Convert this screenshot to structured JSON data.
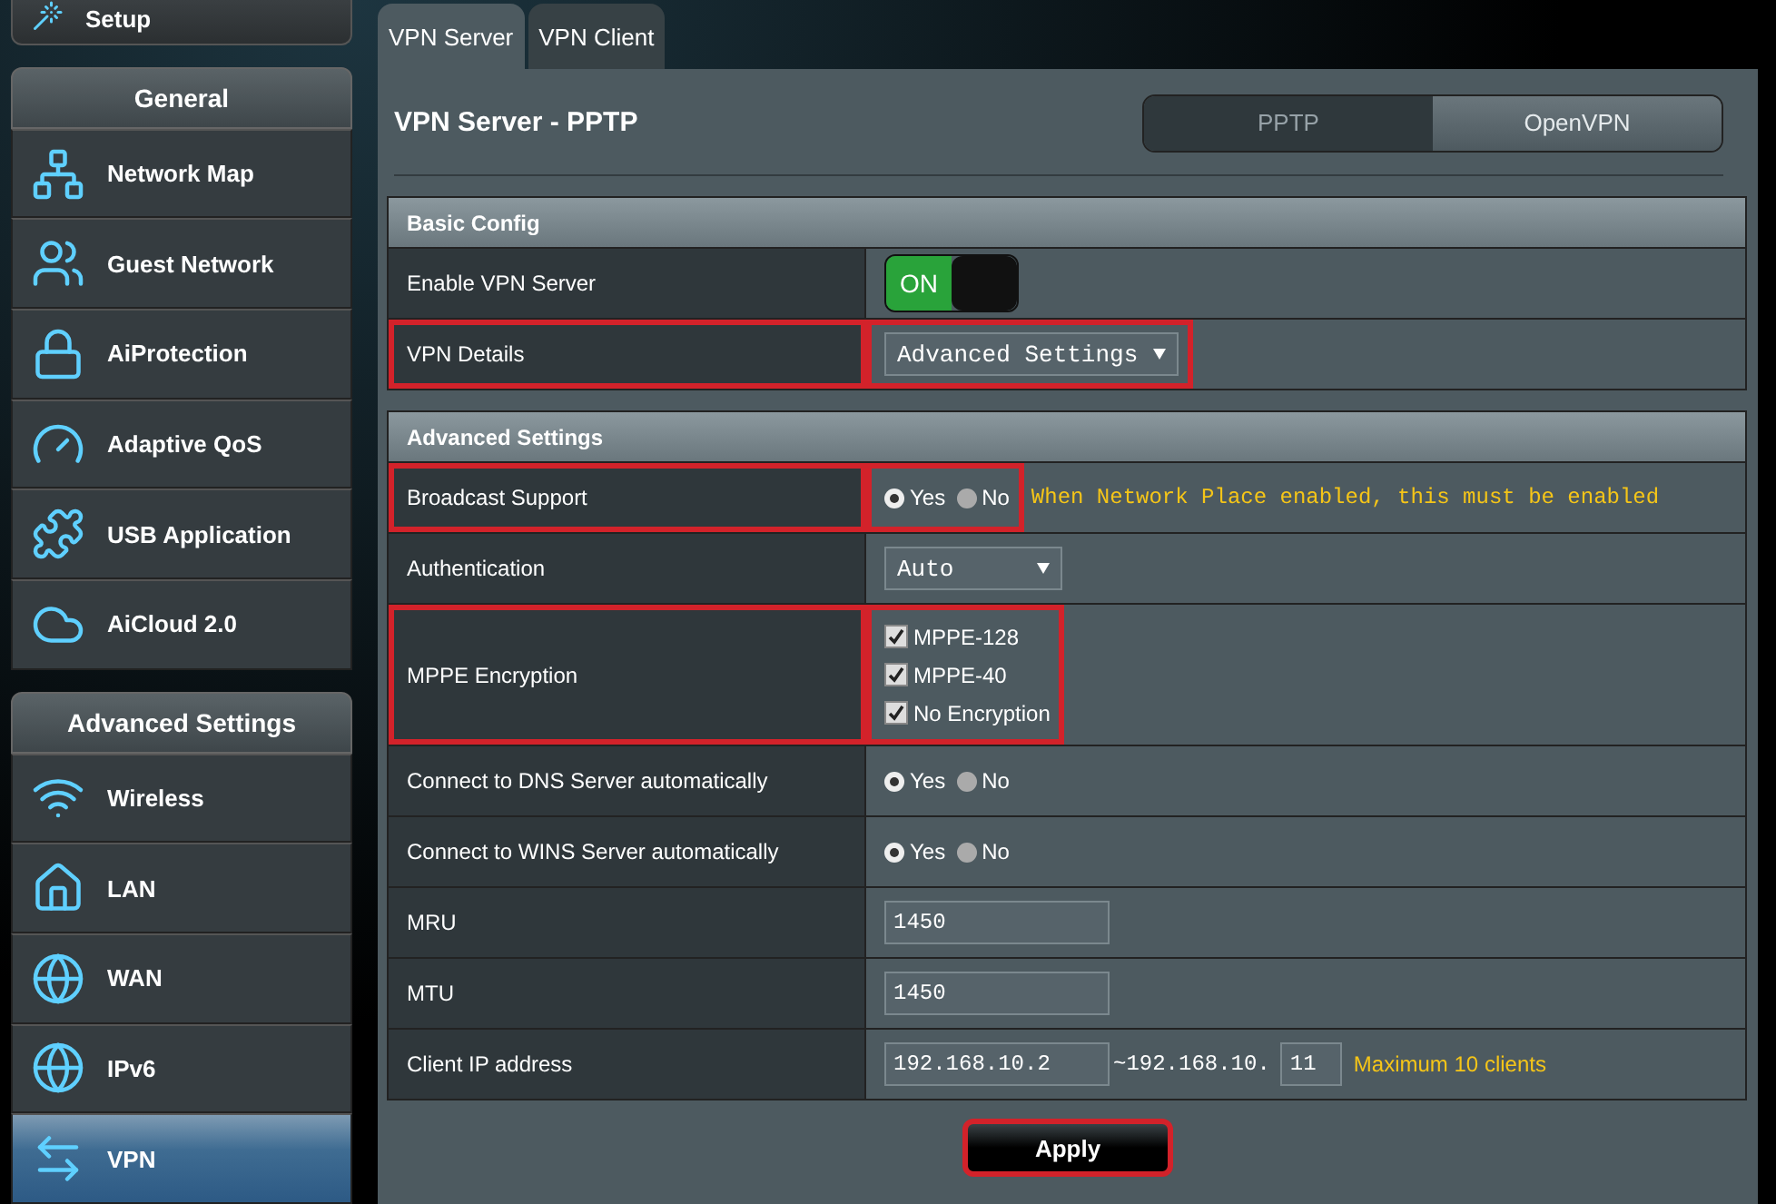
{
  "sidebar": {
    "top_item": {
      "label": "Setup"
    },
    "sections": [
      {
        "title": "General",
        "items": [
          {
            "label": "Network Map",
            "selected": false
          },
          {
            "label": "Guest Network",
            "selected": false
          },
          {
            "label": "AiProtection",
            "selected": false
          },
          {
            "label": "Adaptive QoS",
            "selected": false
          },
          {
            "label": "USB Application",
            "selected": false
          },
          {
            "label": "AiCloud 2.0",
            "selected": false
          }
        ]
      },
      {
        "title": "Advanced Settings",
        "items": [
          {
            "label": "Wireless",
            "selected": false
          },
          {
            "label": "LAN",
            "selected": false
          },
          {
            "label": "WAN",
            "selected": false
          },
          {
            "label": "IPv6",
            "selected": false
          },
          {
            "label": "VPN",
            "selected": true
          }
        ]
      }
    ]
  },
  "tabs": [
    {
      "label": "VPN Server",
      "selected": true
    },
    {
      "label": "VPN Client",
      "selected": false
    }
  ],
  "page_title": "VPN Server - PPTP",
  "protocol_switch": [
    {
      "label": "PPTP",
      "selected": true
    },
    {
      "label": "OpenVPN",
      "selected": false
    }
  ],
  "sections": [
    {
      "title": "Basic Config",
      "rows": [
        {
          "label": "Enable VPN Server",
          "kind": "toggle",
          "value": "ON",
          "on": true,
          "highlighted": false
        },
        {
          "label": "VPN Details",
          "kind": "select",
          "value": "Advanced Settings",
          "highlighted": true
        }
      ]
    },
    {
      "title": "Advanced Settings",
      "rows": [
        {
          "label": "Broadcast Support",
          "kind": "radio",
          "options": [
            {
              "label": "Yes",
              "selected": true
            },
            {
              "label": "No",
              "selected": false
            }
          ],
          "note": "When Network Place enabled, this must be enabled",
          "highlighted": true
        },
        {
          "label": "Authentication",
          "kind": "select",
          "value": "Auto",
          "highlighted": false
        },
        {
          "label": "MPPE Encryption",
          "kind": "checks",
          "options": [
            {
              "label": "MPPE-128",
              "checked": true
            },
            {
              "label": "MPPE-40",
              "checked": true
            },
            {
              "label": "No Encryption",
              "checked": true
            }
          ],
          "highlighted": true
        },
        {
          "label": "Connect to DNS Server automatically",
          "kind": "radio",
          "options": [
            {
              "label": "Yes",
              "selected": true
            },
            {
              "label": "No",
              "selected": false
            }
          ],
          "highlighted": false
        },
        {
          "label": "Connect to WINS Server automatically",
          "kind": "radio",
          "options": [
            {
              "label": "Yes",
              "selected": true
            },
            {
              "label": "No",
              "selected": false
            }
          ],
          "highlighted": false
        },
        {
          "label": "MRU",
          "kind": "input",
          "value": "1450",
          "highlighted": false
        },
        {
          "label": "MTU",
          "kind": "input",
          "value": "1450",
          "highlighted": false
        },
        {
          "label": "Client IP address",
          "kind": "ip_range",
          "value": "192.168.10.2",
          "separator": "~",
          "prefix": "192.168.10.",
          "end": "11",
          "note": "Maximum 10 clients",
          "highlighted": false
        }
      ]
    }
  ],
  "apply_button": {
    "label": "Apply",
    "highlighted": true
  }
}
